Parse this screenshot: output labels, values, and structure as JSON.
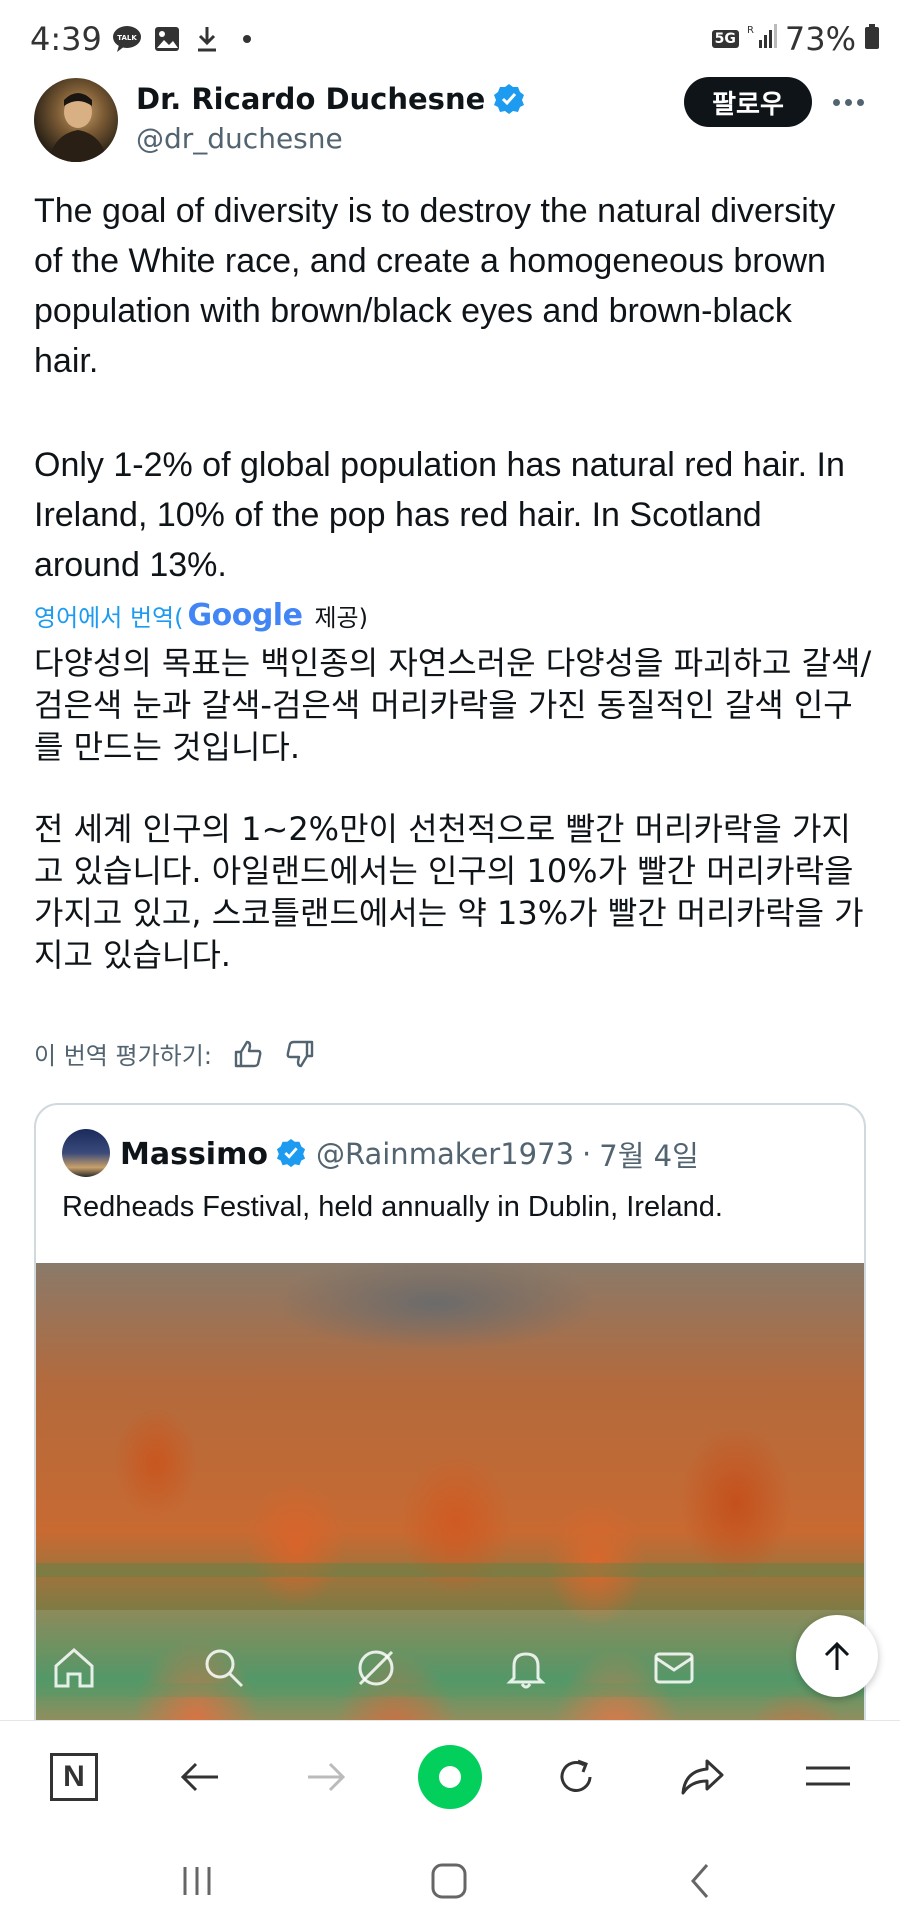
{
  "status_bar": {
    "time": "4:39",
    "network": "5G",
    "battery": "73%",
    "left_icons": [
      "talk-icon",
      "gallery-icon",
      "download-icon",
      "dot-icon"
    ]
  },
  "tweet": {
    "author_name": "Dr. Ricardo Duchesne",
    "handle": "@dr_duchesne",
    "follow_label": "팔로우",
    "text_para1": "The goal of diversity is to destroy the natural diversity of the White race, and create a homogeneous brown population with brown/black eyes and brown-black hair.",
    "text_para2": "Only 1-2% of global population has natural red hair. In Ireland, 10% of the pop has red hair. In Scotland around 13%.",
    "translate_prefix": "영어에서 번역(",
    "translate_provider": "Google",
    "translate_suffix": "제공)",
    "translation_para1": "다양성의 목표는 백인종의 자연스러운 다양성을 파괴하고 갈색/검은색 눈과 갈색-검은색 머리카락을 가진 동질적인 갈색 인구를 만드는 것입니다.",
    "translation_para2": "전 세계 인구의 1~2%만이 선천적으로 빨간 머리카락을 가지고 있습니다. 아일랜드에서는 인구의 10%가 빨간 머리카락을 가지고 있고, 스코틀랜드에서는 약 13%가 빨간 머리카락을 가지고 있습니다.",
    "rate_label": "이 번역 평가하기:"
  },
  "quote": {
    "author_name": "Massimo",
    "handle": "@Rainmaker1973",
    "separator": "·",
    "date": "7월 4일",
    "text": "Redheads Festival, held annually in Dublin, Ireland."
  },
  "x_tabs": [
    "home-icon",
    "search-icon",
    "grok-icon",
    "notifications-icon",
    "messages-icon"
  ],
  "browser_toolbar": {
    "n_label": "N",
    "buttons": [
      "naver-home-button",
      "back-button",
      "forward-button",
      "green-dot-button",
      "reload-button",
      "share-button",
      "menu-button"
    ]
  },
  "colors": {
    "accent": "#1d9bf0",
    "text": "#0f1419",
    "muted": "#536471",
    "naver_green": "#03cf5d"
  }
}
